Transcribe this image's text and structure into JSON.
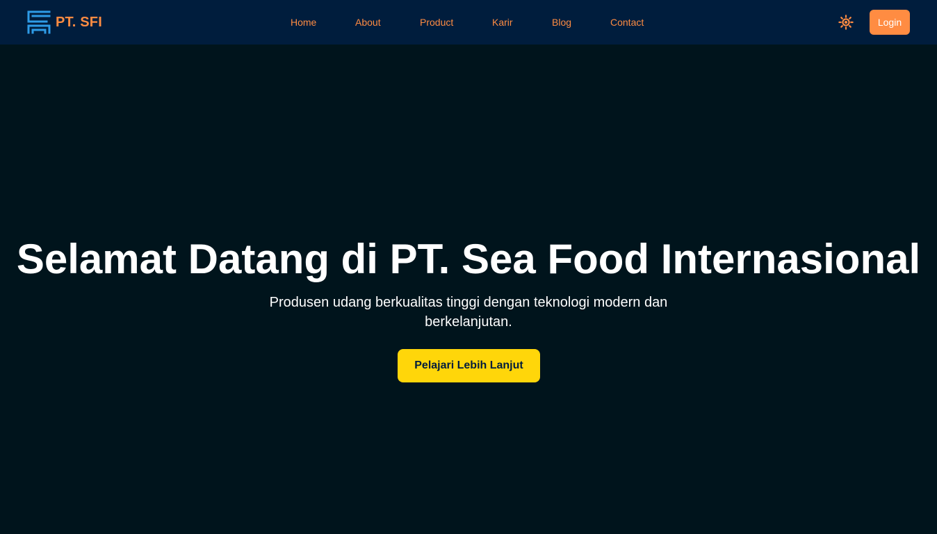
{
  "navbar": {
    "brand_text": "PT. SFI",
    "logo_icon": "sfi-logo-icon",
    "links": [
      "Home",
      "About",
      "Product",
      "Karir",
      "Blog",
      "Contact"
    ],
    "theme_toggle_icon": "sun-icon",
    "login_label": "Login"
  },
  "hero": {
    "title": "Selamat Datang di PT. Sea Food Internasional",
    "subtitle": "Produsen udang berkualitas tinggi dengan teknologi modern dan berkelanjutan.",
    "cta_label": "Pelajari Lebih Lanjut"
  },
  "colors": {
    "navbar_bg": "#001d3d",
    "page_bg": "#00141c",
    "accent_orange": "#ff8c42",
    "cta_yellow": "#ffd60a",
    "logo_blue": "#2e9be6",
    "text_white": "#ffffff"
  }
}
